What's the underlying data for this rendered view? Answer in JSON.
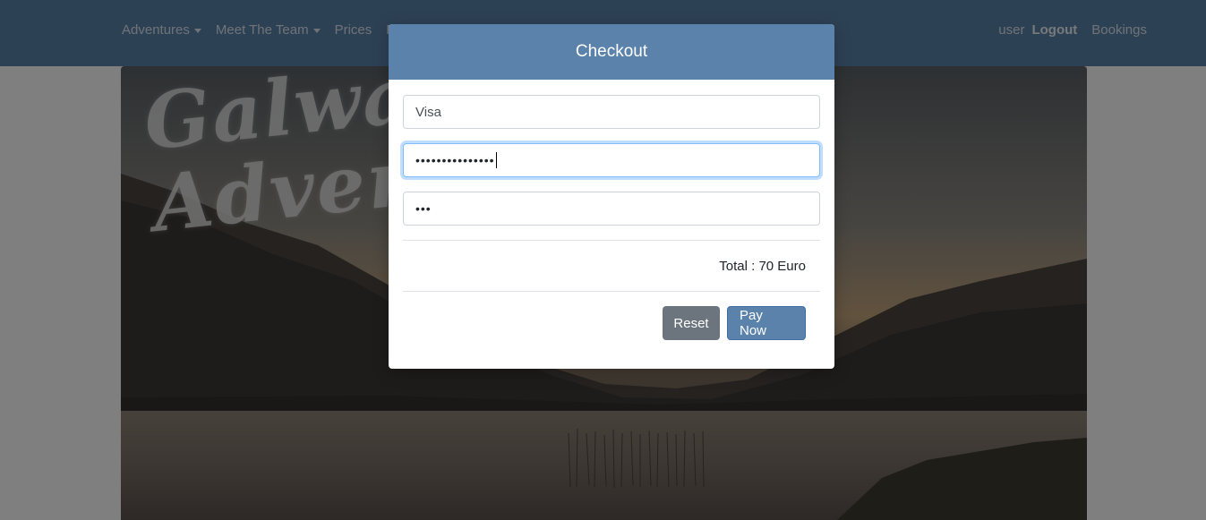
{
  "navbar": {
    "items": [
      {
        "label": "Adventures",
        "dropdown": true
      },
      {
        "label": "Meet The Team",
        "dropdown": true
      },
      {
        "label": "Prices",
        "dropdown": false
      },
      {
        "label": "B",
        "dropdown": false
      }
    ],
    "user": "user",
    "logout": "Logout",
    "bookings": "Bookings"
  },
  "hero": {
    "logo_line1": "Galway",
    "logo_line2": "Advent"
  },
  "modal": {
    "title": "Checkout",
    "card_type_value": "Visa",
    "card_number_value": "•••••••••••••••",
    "cvv_value": "•••",
    "total": "Total : 70 Euro",
    "reset_label": "Reset",
    "pay_label": "Pay Now"
  },
  "colors": {
    "primary": "#5a82aa",
    "secondary": "#6c757d"
  }
}
